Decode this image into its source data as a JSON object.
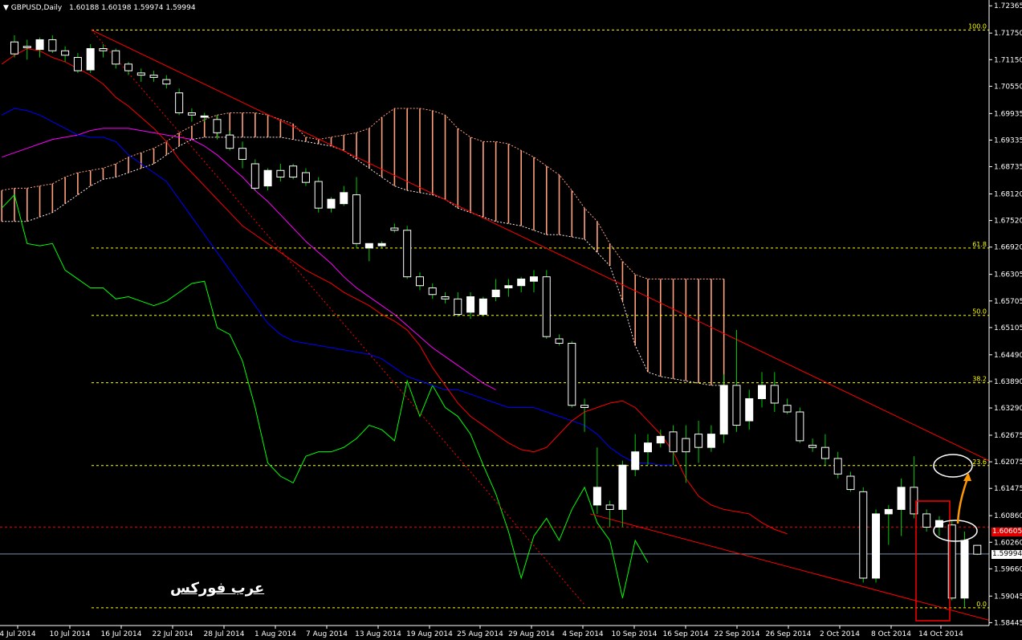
{
  "header": {
    "symbol_label": "GBPUSD,Daily",
    "ohlc": "1.60188 1.60198 1.59974 1.59994"
  },
  "watermark": "عرب فوركس",
  "price_tags": {
    "red": "1.60605",
    "current": "1.59994"
  },
  "colors": {
    "background": "#000000",
    "bull_candle": "#ffffff",
    "bear_candle": "#000000",
    "candle_wick": "#00cc00",
    "tenkan": "#ff0000",
    "kijun": "#0000ff",
    "ma": "#ff00ff",
    "chikou": "#00ff00",
    "cloud_bull": "#ffa07a",
    "cloud_bear": "#ffe4e1",
    "fib": "#ffff00",
    "trendline": "#ff0000",
    "arrow": "#ff9900"
  },
  "chart_data": {
    "type": "candlestick",
    "symbol": "GBPUSD",
    "timeframe": "Daily",
    "y_ticks": [
      "1.72365",
      "1.71750",
      "1.71150",
      "1.70550",
      "1.69935",
      "1.69335",
      "1.68735",
      "1.68120",
      "1.67520",
      "1.66920",
      "1.66305",
      "1.65705",
      "1.65105",
      "1.64490",
      "1.63890",
      "1.63290",
      "1.62675",
      "1.62075",
      "1.61475",
      "1.60860",
      "1.60260",
      "1.59660",
      "1.59045",
      "1.58445"
    ],
    "y_range": [
      1.5838,
      1.7246
    ],
    "x_ticks": [
      "4 Jul 2014",
      "10 Jul 2014",
      "16 Jul 2014",
      "22 Jul 2014",
      "28 Jul 2014",
      "1 Aug 2014",
      "7 Aug 2014",
      "13 Aug 2014",
      "19 Aug 2014",
      "25 Aug 2014",
      "29 Aug 2014",
      "4 Sep 2014",
      "10 Sep 2014",
      "16 Sep 2014",
      "22 Sep 2014",
      "26 Sep 2014",
      "2 Oct 2014",
      "8 Oct 2014",
      "14 Oct 2014"
    ],
    "fibonacci": [
      {
        "label": "100.0",
        "value": 1.7182
      },
      {
        "label": "61.8",
        "value": 1.669
      },
      {
        "label": "50.0",
        "value": 1.6538
      },
      {
        "label": "38.2",
        "value": 1.6386
      },
      {
        "label": "23.6",
        "value": 1.6199
      },
      {
        "label": "0.0",
        "value": 1.5878
      }
    ],
    "candles": [
      [
        1.7155,
        1.717,
        1.712,
        1.7128
      ],
      [
        1.7145,
        1.716,
        1.7115,
        1.7142
      ],
      [
        1.7138,
        1.7165,
        1.712,
        1.716
      ],
      [
        1.716,
        1.717,
        1.713,
        1.7135
      ],
      [
        1.7135,
        1.7145,
        1.711,
        1.7125
      ],
      [
        1.712,
        1.713,
        1.7085,
        1.709
      ],
      [
        1.7092,
        1.715,
        1.7085,
        1.714
      ],
      [
        1.714,
        1.715,
        1.712,
        1.7135
      ],
      [
        1.7135,
        1.714,
        1.7095,
        1.7105
      ],
      [
        1.7105,
        1.711,
        1.708,
        1.709
      ],
      [
        1.7085,
        1.7095,
        1.7065,
        1.708
      ],
      [
        1.708,
        1.709,
        1.7065,
        1.7075
      ],
      [
        1.707,
        1.708,
        1.705,
        1.706
      ],
      [
        1.704,
        1.705,
        1.699,
        1.6995
      ],
      [
        1.6995,
        1.7005,
        1.6975,
        1.699
      ],
      [
        1.6985,
        1.6995,
        1.6975,
        1.6988
      ],
      [
        1.698,
        1.699,
        1.6935,
        1.695
      ],
      [
        1.6945,
        1.6955,
        1.691,
        1.6915
      ],
      [
        1.6915,
        1.693,
        1.687,
        1.689
      ],
      [
        1.688,
        1.689,
        1.682,
        1.6825
      ],
      [
        1.683,
        1.687,
        1.682,
        1.6865
      ],
      [
        1.6865,
        1.688,
        1.684,
        1.685
      ],
      [
        1.6875,
        1.688,
        1.6845,
        1.685
      ],
      [
        1.686,
        1.687,
        1.683,
        1.6838
      ],
      [
        1.684,
        1.685,
        1.677,
        1.678
      ],
      [
        1.678,
        1.6805,
        1.677,
        1.68
      ],
      [
        1.679,
        1.683,
        1.6785,
        1.6815
      ],
      [
        1.681,
        1.685,
        1.669,
        1.67
      ],
      [
        1.669,
        1.67,
        1.666,
        1.67
      ],
      [
        1.6695,
        1.6705,
        1.669,
        1.67
      ],
      [
        1.6735,
        1.6745,
        1.6725,
        1.673
      ],
      [
        1.673,
        1.674,
        1.662,
        1.6625
      ],
      [
        1.6625,
        1.6635,
        1.6595,
        1.6605
      ],
      [
        1.66,
        1.661,
        1.6575,
        1.6585
      ],
      [
        1.658,
        1.659,
        1.6565,
        1.6575
      ],
      [
        1.6575,
        1.659,
        1.6535,
        1.654
      ],
      [
        1.6545,
        1.659,
        1.653,
        1.658
      ],
      [
        1.654,
        1.658,
        1.6535,
        1.6575
      ],
      [
        1.658,
        1.662,
        1.657,
        1.6595
      ],
      [
        1.66,
        1.662,
        1.658,
        1.6605
      ],
      [
        1.6605,
        1.6625,
        1.659,
        1.662
      ],
      [
        1.6615,
        1.664,
        1.659,
        1.6625
      ],
      [
        1.6625,
        1.664,
        1.6485,
        1.649
      ],
      [
        1.6485,
        1.6495,
        1.647,
        1.6475
      ],
      [
        1.6475,
        1.648,
        1.633,
        1.6335
      ],
      [
        1.6335,
        1.635,
        1.6275,
        1.633
      ],
      [
        1.611,
        1.624,
        1.609,
        1.615
      ],
      [
        1.611,
        1.612,
        1.606,
        1.61
      ],
      [
        1.61,
        1.621,
        1.606,
        1.62
      ],
      [
        1.619,
        1.627,
        1.6175,
        1.623
      ],
      [
        1.623,
        1.627,
        1.62,
        1.625
      ],
      [
        1.625,
        1.628,
        1.624,
        1.6265
      ],
      [
        1.6275,
        1.629,
        1.62,
        1.623
      ],
      [
        1.626,
        1.629,
        1.616,
        1.623
      ],
      [
        1.627,
        1.63,
        1.6205,
        1.624
      ],
      [
        1.624,
        1.629,
        1.623,
        1.627
      ],
      [
        1.627,
        1.6405,
        1.625,
        1.638
      ],
      [
        1.638,
        1.6505,
        1.6275,
        1.629
      ],
      [
        1.63,
        1.637,
        1.628,
        1.635
      ],
      [
        1.635,
        1.641,
        1.633,
        1.638
      ],
      [
        1.638,
        1.641,
        1.632,
        1.634
      ],
      [
        1.6335,
        1.635,
        1.6315,
        1.632
      ],
      [
        1.632,
        1.633,
        1.625,
        1.6255
      ],
      [
        1.6245,
        1.626,
        1.623,
        1.624
      ],
      [
        1.624,
        1.627,
        1.62,
        1.6215
      ],
      [
        1.6215,
        1.623,
        1.617,
        1.618
      ],
      [
        1.6175,
        1.6185,
        1.614,
        1.6145
      ],
      [
        1.614,
        1.615,
        1.5935,
        1.5945
      ],
      [
        1.5945,
        1.61,
        1.5935,
        1.609
      ],
      [
        1.609,
        1.611,
        1.602,
        1.61
      ],
      [
        1.61,
        1.617,
        1.604,
        1.615
      ],
      [
        1.615,
        1.622,
        1.608,
        1.609
      ],
      [
        1.609,
        1.61,
        1.605,
        1.606
      ],
      [
        1.606,
        1.6085,
        1.604,
        1.6075
      ],
      [
        1.6065,
        1.6075,
        1.5895,
        1.59
      ],
      [
        1.59,
        1.605,
        1.588,
        1.603
      ],
      [
        1.6019,
        1.602,
        1.5997,
        1.5999
      ]
    ],
    "tenkan": [
      1.7105,
      1.7125,
      1.714,
      1.7135,
      1.712,
      1.711,
      1.7095,
      1.708,
      1.706,
      1.703,
      1.701,
      1.6985,
      1.696,
      1.693,
      1.689,
      1.686,
      1.683,
      1.68,
      1.677,
      1.674,
      1.672,
      1.67,
      1.668,
      1.666,
      1.664,
      1.6625,
      1.661,
      1.659,
      1.6575,
      1.656,
      1.654,
      1.6525,
      1.6505,
      1.647,
      1.642,
      1.638,
      1.634,
      1.631,
      1.629,
      1.627,
      1.625,
      1.6235,
      1.623,
      1.624,
      1.627,
      1.63,
      1.632,
      1.633,
      1.634,
      1.6345,
      1.633,
      1.63,
      1.627,
      1.623,
      1.617,
      1.613,
      1.611,
      1.61,
      1.6095,
      1.609,
      1.607,
      1.6055,
      1.6045
    ],
    "kijun": [
      1.699,
      1.7005,
      1.7,
      1.699,
      1.6975,
      1.696,
      1.6945,
      1.694,
      1.694,
      1.693,
      1.69,
      1.688,
      1.686,
      1.684,
      1.68,
      1.676,
      1.672,
      1.668,
      1.664,
      1.66,
      1.656,
      1.652,
      1.6495,
      1.648,
      1.6475,
      1.647,
      1.6465,
      1.646,
      1.6455,
      1.645,
      1.644,
      1.642,
      1.64,
      1.639,
      1.638,
      1.637,
      1.637,
      1.636,
      1.635,
      1.634,
      1.633,
      1.633,
      1.633,
      1.632,
      1.631,
      1.63,
      1.629,
      1.627,
      1.624,
      1.622,
      1.6205,
      1.6205,
      1.62,
      1.62
    ],
    "ma": [
      1.6895,
      1.6905,
      1.6915,
      1.6925,
      1.6935,
      1.694,
      1.6945,
      1.6955,
      1.696,
      1.696,
      1.696,
      1.6955,
      1.695,
      1.6945,
      1.694,
      1.6935,
      1.692,
      1.69,
      1.6875,
      1.685,
      1.682,
      1.6795,
      1.6765,
      1.6735,
      1.6705,
      1.668,
      1.6655,
      1.6625,
      1.66,
      1.658,
      1.656,
      1.654,
      1.6515,
      1.649,
      1.6465,
      1.6445,
      1.6425,
      1.6405,
      1.6385,
      1.637
    ],
    "chikou": [
      1.678,
      1.681,
      1.67,
      1.6695,
      1.67,
      1.664,
      1.662,
      1.66,
      1.66,
      1.6575,
      1.658,
      1.657,
      1.656,
      1.657,
      1.659,
      1.661,
      1.6615,
      1.651,
      1.6495,
      1.6435,
      1.633,
      1.6205,
      1.6175,
      1.616,
      1.622,
      1.623,
      1.623,
      1.624,
      1.626,
      1.629,
      1.628,
      1.6255,
      1.639,
      1.631,
      1.638,
      1.633,
      1.631,
      1.627,
      1.62,
      1.6135,
      1.605,
      1.5945,
      1.604,
      1.608,
      1.603,
      1.61,
      1.615,
      1.607,
      1.603,
      1.59,
      1.603,
      1.598
    ],
    "senkou_a": [
      1.682,
      1.6825,
      1.6825,
      1.683,
      1.6835,
      1.685,
      1.686,
      1.6865,
      1.687,
      1.688,
      1.6895,
      1.6905,
      1.6915,
      1.693,
      1.695,
      1.6965,
      1.698,
      1.699,
      1.6995,
      1.6995,
      1.6995,
      1.699,
      1.698,
      1.697,
      1.694,
      1.6935,
      1.694,
      1.6945,
      1.695,
      1.696,
      1.6985,
      1.7005,
      1.7005,
      1.7005,
      1.7,
      1.699,
      1.696,
      1.694,
      1.693,
      1.693,
      1.6925,
      1.691,
      1.6895,
      1.6875,
      1.6855,
      1.682,
      1.678,
      1.675,
      1.67,
      1.666,
      1.663,
      1.662,
      1.662,
      1.662,
      1.662,
      1.662,
      1.662,
      1.662
    ],
    "senkou_b": [
      1.675,
      1.675,
      1.675,
      1.676,
      1.677,
      1.679,
      1.681,
      1.683,
      1.6845,
      1.685,
      1.686,
      1.687,
      1.688,
      1.69,
      1.692,
      1.6935,
      1.694,
      1.694,
      1.694,
      1.694,
      1.694,
      1.694,
      1.694,
      1.6935,
      1.693,
      1.6925,
      1.692,
      1.691,
      1.689,
      1.687,
      1.685,
      1.683,
      1.682,
      1.6815,
      1.681,
      1.68,
      1.678,
      1.677,
      1.676,
      1.675,
      1.6745,
      1.674,
      1.673,
      1.672,
      1.672,
      1.6715,
      1.671,
      1.668,
      1.665,
      1.657,
      1.647,
      1.641,
      1.64,
      1.6395,
      1.639,
      1.6385,
      1.638,
      1.638
    ],
    "trendlines": [
      {
        "from": [
          "16 Jul 2014",
          1.7182
        ],
        "to": [
          "20 Oct 2014",
          1.621
        ],
        "style": "solid"
      },
      {
        "from": [
          "8 Sep 2014",
          1.611
        ],
        "to": [
          "20 Oct 2014",
          1.585
        ],
        "style": "solid"
      },
      {
        "from": [
          "16 Jul 2014",
          1.7182
        ],
        "to": [
          "4 Sep 2014",
          1.5885
        ],
        "style": "dotted"
      }
    ]
  }
}
